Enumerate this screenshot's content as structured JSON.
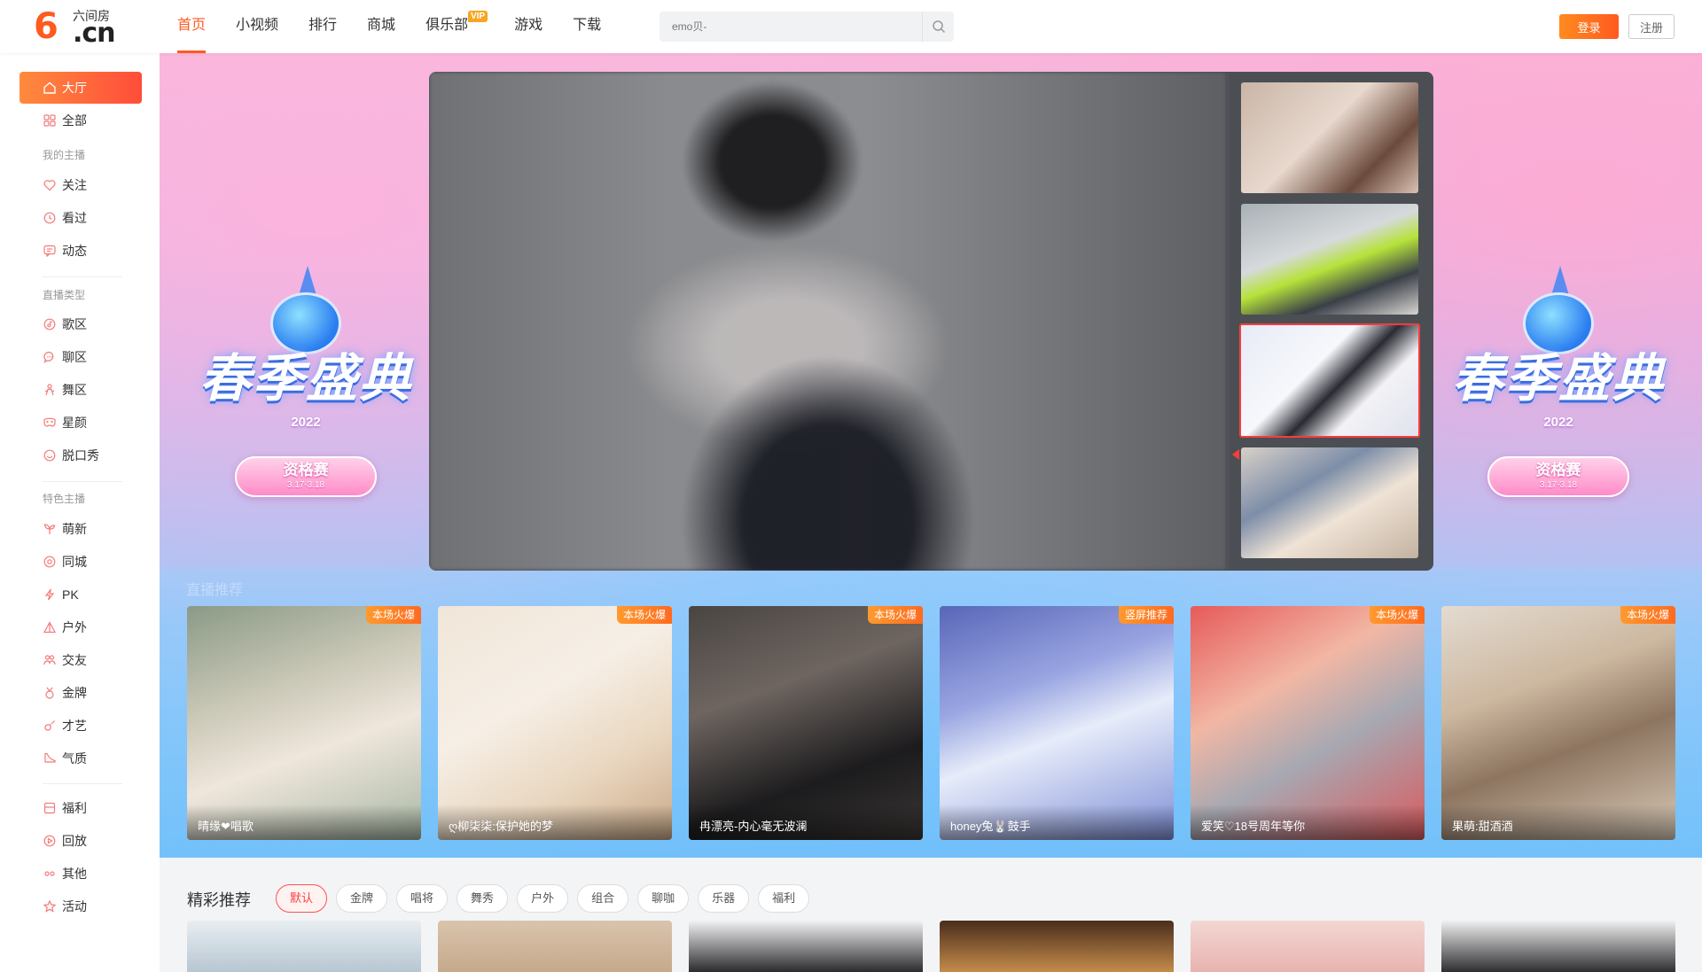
{
  "header": {
    "logo_sub": "六间房",
    "logo_main": "6",
    "logo_cn": ".cn",
    "nav": [
      {
        "label": "首页",
        "active": true
      },
      {
        "label": "小视频"
      },
      {
        "label": "排行"
      },
      {
        "label": "商城"
      },
      {
        "label": "俱乐部",
        "badge": "VIP"
      },
      {
        "label": "游戏"
      },
      {
        "label": "下载"
      }
    ],
    "search_placeholder": "emo贝-",
    "login_label": "登录",
    "register_label": "注册"
  },
  "sidebar": {
    "items": [
      {
        "label": "大厅",
        "icon": "home-icon",
        "active": true
      },
      {
        "label": "全部",
        "icon": "grid-icon"
      },
      {
        "label": "关注",
        "icon": "heart-icon"
      },
      {
        "label": "看过",
        "icon": "clock-icon"
      },
      {
        "label": "动态",
        "icon": "message-icon"
      },
      {
        "label": "歌区",
        "icon": "music-icon"
      },
      {
        "label": "聊区",
        "icon": "chat-icon"
      },
      {
        "label": "舞区",
        "icon": "dance-icon"
      },
      {
        "label": "星颜",
        "icon": "mask-icon"
      },
      {
        "label": "脱口秀",
        "icon": "talk-icon"
      },
      {
        "label": "萌新",
        "icon": "sprout-icon"
      },
      {
        "label": "同城",
        "icon": "location-icon"
      },
      {
        "label": "PK",
        "icon": "lightning-icon"
      },
      {
        "label": "户外",
        "icon": "tent-icon"
      },
      {
        "label": "交友",
        "icon": "friends-icon"
      },
      {
        "label": "金牌",
        "icon": "medal-icon"
      },
      {
        "label": "才艺",
        "icon": "guitar-icon"
      },
      {
        "label": "气质",
        "icon": "shoe-icon"
      },
      {
        "label": "福利",
        "icon": "gift-icon"
      },
      {
        "label": "回放",
        "icon": "replay-icon"
      },
      {
        "label": "其他",
        "icon": "dots-icon"
      },
      {
        "label": "活动",
        "icon": "star-icon"
      }
    ],
    "groups": [
      "我的主播",
      "直播类型",
      "特色主播"
    ]
  },
  "banner": {
    "title": "春季盛典",
    "year": "2022",
    "stage": "资格赛",
    "dates": "3.17-3.18",
    "section_label": "直播推荐"
  },
  "player": {
    "thumbnails": [
      {
        "selected": false
      },
      {
        "selected": false
      },
      {
        "selected": true
      },
      {
        "selected": false
      }
    ]
  },
  "live_cards": [
    {
      "name": "晴缘❤唱歌",
      "tag": "本场火爆"
    },
    {
      "name": "ღ柳柒柒:保护她的梦",
      "tag": "本场火爆"
    },
    {
      "name": "冉漂亮-内心毫无波澜",
      "tag": "本场火爆"
    },
    {
      "name": "honey兔🐰鼓手",
      "tag": "竖屏推荐"
    },
    {
      "name": "爱笑♡18号周年等你",
      "tag": "本场火爆"
    },
    {
      "name": "果萌:甜酒酒",
      "tag": "本场火爆"
    }
  ],
  "recommend": {
    "title": "精彩推荐",
    "filters": [
      "默认",
      "金牌",
      "唱将",
      "舞秀",
      "户外",
      "组合",
      "聊咖",
      "乐器",
      "福利"
    ],
    "active_filter": 0
  },
  "colors": {
    "accent": "#ff5a1f",
    "tag": "#ff7a1f",
    "active_filter": "#ff3b3b"
  }
}
